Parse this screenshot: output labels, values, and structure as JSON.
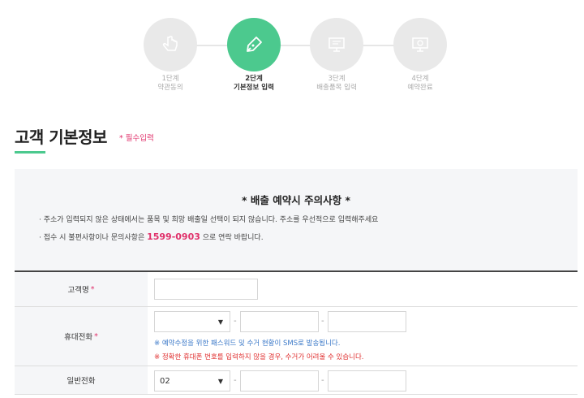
{
  "steps": [
    {
      "num": "1단계",
      "label": "약관동의",
      "icon": "hand-pointer-icon",
      "active": false
    },
    {
      "num": "2단계",
      "label": "기본정보 입력",
      "icon": "pen-nib-icon",
      "active": true
    },
    {
      "num": "3단계",
      "label": "배출품목 입력",
      "icon": "monitor-icon",
      "active": false
    },
    {
      "num": "4단계",
      "label": "예약완료",
      "icon": "monitor-check-icon",
      "active": false
    }
  ],
  "section": {
    "title": "고객 기본정보",
    "required_note": "* 필수입력"
  },
  "notice": {
    "title": "* 배출 예약시 주의사항 *",
    "line1": "· 주소가 입력되지 않은 상태에서는 품목 및 희망 배출일 선택이 되지 않습니다. 주소를 우선적으로 입력해주세요",
    "line2_prefix": "· 접수 시 불편사항이나 문의사항은 ",
    "phone": "1599-0903",
    "line2_suffix": " 으로 연락 바랍니다."
  },
  "form": {
    "name_label": "고객명",
    "mobile_label": "휴대전화",
    "mobile_select_value": "",
    "mobile_hint1": "※ 예약수정을 위한 패스워드 및 수거 현황이 SMS로 발송됩니다.",
    "mobile_hint2": "※ 정확한 휴대폰 번호를 입력하지 않을 경우, 수거가 어려울 수 있습니다.",
    "phone_label": "일반전화",
    "phone_select_value": "02",
    "required_mark": "*",
    "dash": "-",
    "arrow": "▼"
  },
  "colors": {
    "accent": "#4cc98e",
    "required": "#e0306a",
    "hint_blue": "#3a78c8",
    "hint_red": "#e03030"
  }
}
